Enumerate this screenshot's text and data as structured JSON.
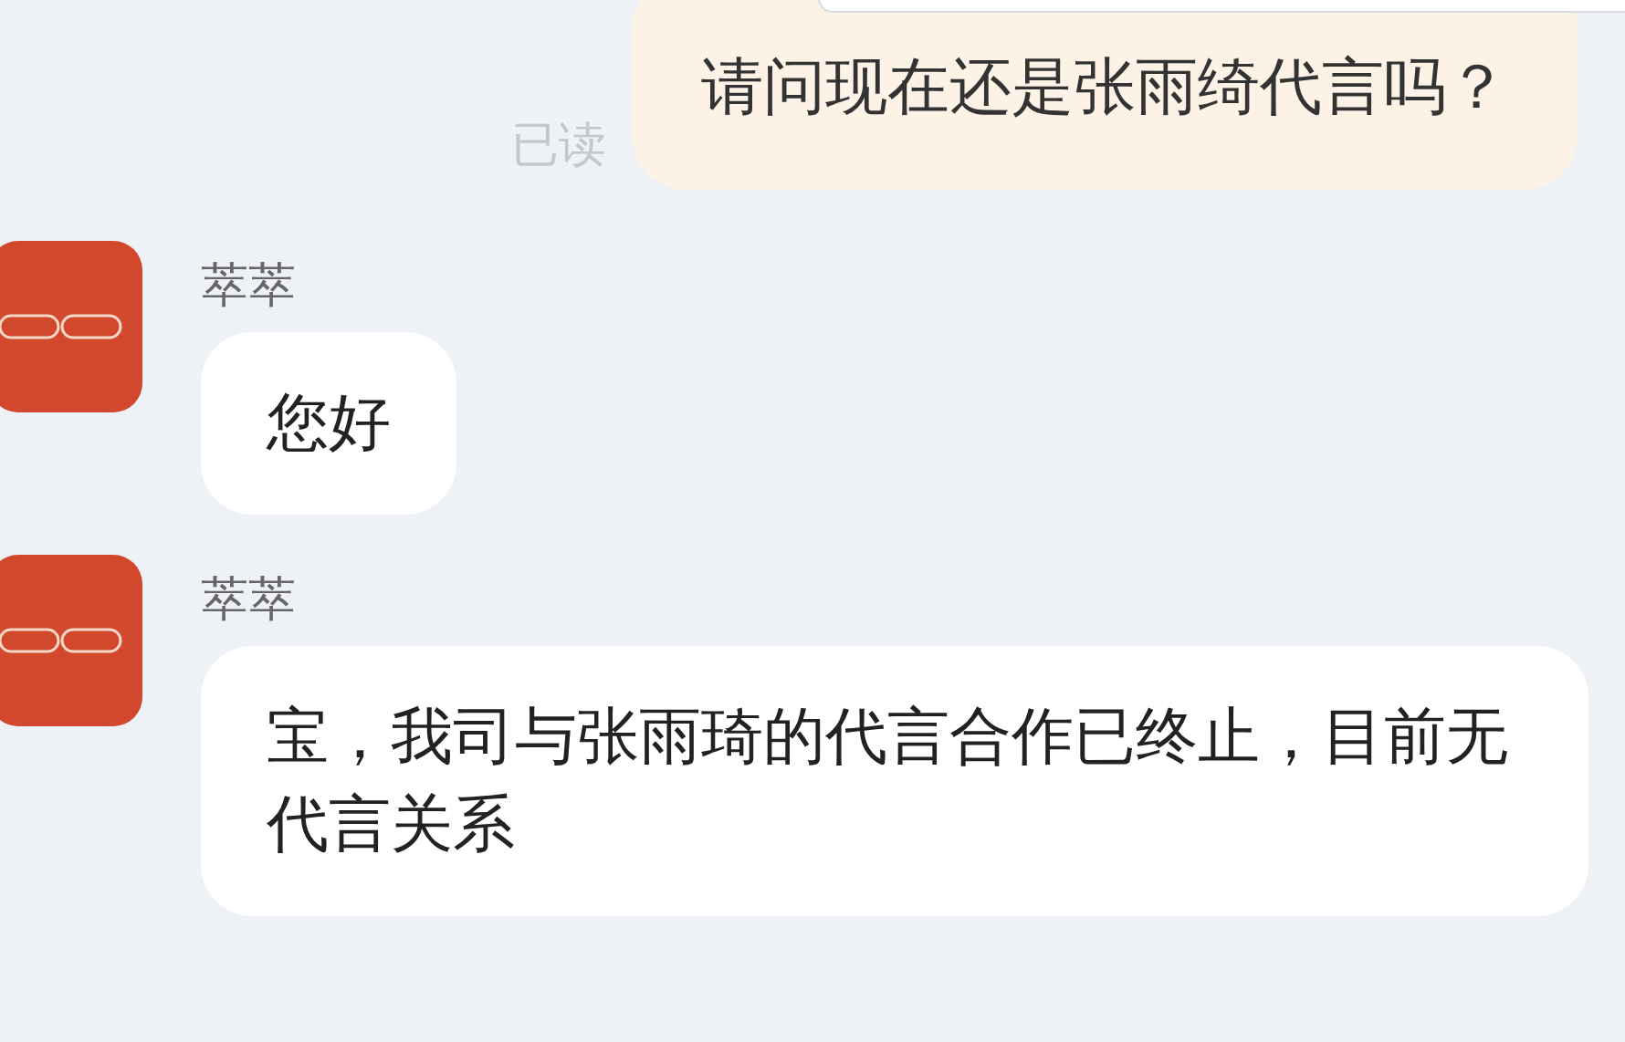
{
  "outgoing": {
    "text": "请问现在还是张雨绮代言吗？",
    "status": "已读"
  },
  "messages": [
    {
      "sender": "萃萃",
      "text": "您好"
    },
    {
      "sender": "萃萃",
      "text": "宝，我司与张雨琦的代言合作已终止，目前无代言关系"
    }
  ]
}
